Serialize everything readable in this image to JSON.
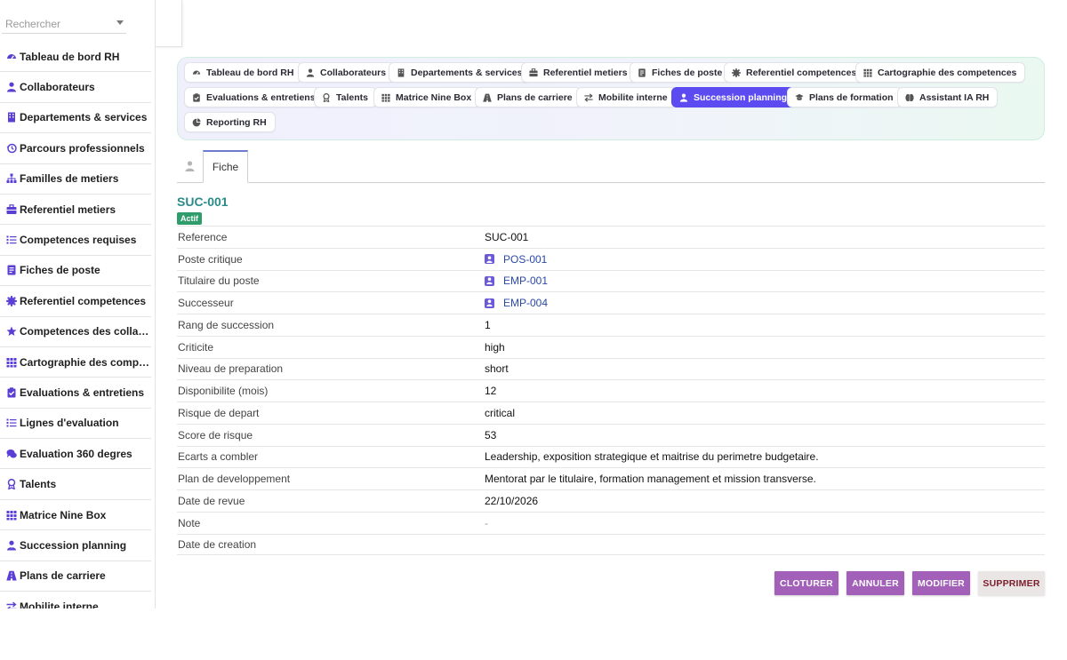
{
  "search": {
    "placeholder": "Rechercher"
  },
  "sidebar": {
    "items": [
      {
        "label": "Tableau de bord RH",
        "icon": "dashboard-icon"
      },
      {
        "label": "Collaborateurs",
        "icon": "person-icon"
      },
      {
        "label": "Departements & services",
        "icon": "building-icon"
      },
      {
        "label": "Parcours professionnels",
        "icon": "history-icon"
      },
      {
        "label": "Familles de metiers",
        "icon": "sitemap-icon"
      },
      {
        "label": "Referentiel metiers",
        "icon": "briefcase-icon"
      },
      {
        "label": "Competences requises",
        "icon": "list-icon"
      },
      {
        "label": "Fiches de poste",
        "icon": "id-card-icon"
      },
      {
        "label": "Referentiel competences",
        "icon": "badge-icon"
      },
      {
        "label": "Competences des collaborateurs",
        "icon": "star-icon"
      },
      {
        "label": "Cartographie des competences",
        "icon": "grid-icon"
      },
      {
        "label": "Evaluations & entretiens",
        "icon": "clipboard-check-icon"
      },
      {
        "label": "Lignes d'evaluation",
        "icon": "list-icon"
      },
      {
        "label": "Evaluation 360 degres",
        "icon": "comments-icon"
      },
      {
        "label": "Talents",
        "icon": "award-icon"
      },
      {
        "label": "Matrice Nine Box",
        "icon": "grid-icon"
      },
      {
        "label": "Succession planning",
        "icon": "user-tie-icon"
      },
      {
        "label": "Plans de carriere",
        "icon": "road-icon"
      },
      {
        "label": "Mobilite interne",
        "icon": "exchange-icon"
      }
    ]
  },
  "nav": {
    "pills": [
      {
        "label": "Tableau de bord RH",
        "icon": "dashboard-icon"
      },
      {
        "label": "Collaborateurs",
        "icon": "person-icon"
      },
      {
        "label": "Departements & services",
        "icon": "building-icon"
      },
      {
        "label": "Referentiel metiers",
        "icon": "briefcase-icon"
      },
      {
        "label": "Fiches de poste",
        "icon": "id-card-icon"
      },
      {
        "label": "Referentiel competences",
        "icon": "badge-icon"
      },
      {
        "label": "Cartographie des competences",
        "icon": "grid-icon"
      },
      {
        "label": "Evaluations & entretiens",
        "icon": "clipboard-check-icon"
      },
      {
        "label": "Talents",
        "icon": "award-icon"
      },
      {
        "label": "Matrice Nine Box",
        "icon": "grid-icon"
      },
      {
        "label": "Plans de carriere",
        "icon": "road-icon"
      },
      {
        "label": "Mobilite interne",
        "icon": "exchange-icon"
      },
      {
        "label": "Succession planning",
        "icon": "user-tie-icon",
        "active": true
      },
      {
        "label": "Plans de formation",
        "icon": "graduation-cap-icon"
      },
      {
        "label": "Assistant IA RH",
        "icon": "brain-icon"
      },
      {
        "label": "Reporting RH",
        "icon": "pie-chart-icon"
      }
    ]
  },
  "tabs": {
    "fiche": "Fiche"
  },
  "record": {
    "title": "SUC-001",
    "status": "Actif",
    "fields": [
      {
        "label": "Reference",
        "value": "SUC-001"
      },
      {
        "label": "Poste critique",
        "value": "POS-001",
        "link": true
      },
      {
        "label": "Titulaire du poste",
        "value": "EMP-001",
        "link": true
      },
      {
        "label": "Successeur",
        "value": "EMP-004",
        "link": true
      },
      {
        "label": "Rang de succession",
        "value": "1"
      },
      {
        "label": "Criticite",
        "value": "high"
      },
      {
        "label": "Niveau de preparation",
        "value": "short"
      },
      {
        "label": "Disponibilite (mois)",
        "value": "12"
      },
      {
        "label": "Risque de depart",
        "value": "critical"
      },
      {
        "label": "Score de risque",
        "value": "53"
      },
      {
        "label": "Ecarts a combler",
        "value": "Leadership, exposition strategique et maitrise du perimetre budgetaire."
      },
      {
        "label": "Plan de developpement",
        "value": "Mentorat par le titulaire, formation management et mission transverse."
      },
      {
        "label": "Date de revue",
        "value": "22/10/2026"
      },
      {
        "label": "Note",
        "value": "-",
        "muted": true
      },
      {
        "label": "Date de creation",
        "value": ""
      }
    ]
  },
  "actions": {
    "cloturer": "CLOTURER",
    "annuler": "ANNULER",
    "modifier": "MODIFIER",
    "supprimer": "SUPPRIMER"
  },
  "colors": {
    "accent": "#5b4bf0",
    "title": "#2b8a8a",
    "status": "#2f9d6b",
    "action": "#a260b8",
    "danger_text": "#7a1e2a"
  }
}
